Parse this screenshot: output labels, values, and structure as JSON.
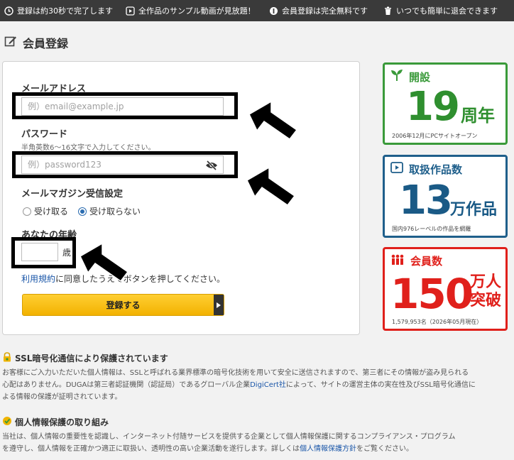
{
  "topbar": {
    "items": [
      {
        "icon": "clock-icon",
        "text": "登録は約30秒で完了します"
      },
      {
        "icon": "play-icon",
        "text": "全作品のサンプル動画が見放題！"
      },
      {
        "icon": "free-icon",
        "text": "会員登録は完全無料です"
      },
      {
        "icon": "trash-icon",
        "text": "いつでも簡単に退会できます"
      }
    ]
  },
  "page": {
    "title": "会員登録",
    "title_icon": "edit-icon"
  },
  "form": {
    "email_label": "メールアドレス",
    "email_placeholder": "例）email@example.jp",
    "password_label": "パスワード",
    "password_hint": "半角英数6～16文字で入力してください。",
    "password_placeholder": "例）password123",
    "password_toggle_icon": "eye-slash-icon",
    "newsletter_label": "メールマガジン受信設定",
    "newsletter_options": [
      {
        "label": "受け取る",
        "selected": false
      },
      {
        "label": "受け取らない",
        "selected": true
      }
    ],
    "age_label": "あなたの年齢",
    "age_value": "",
    "age_unit": "歳",
    "terms_link": "利用規約",
    "terms_text_1": "に同意したうえで",
    "terms_text_2": "ボタンを押してください。",
    "submit_label": "登録する"
  },
  "stats": [
    {
      "icon": "sprout-icon",
      "title": "開設",
      "number": "19",
      "unit": "周年",
      "note": "2006年12月にPCサイトオープン",
      "color": "#3a9a3a",
      "number_color": "#2f8f2f"
    },
    {
      "icon": "video-icon",
      "title": "取扱作品数",
      "number": "13",
      "unit": "万作品",
      "note": "国内976レーベルの作品を網羅",
      "color": "#1f5f8b",
      "number_color": "#1a5a86"
    },
    {
      "icon": "people-icon",
      "title": "会員数",
      "number": "150",
      "unit_line1": "万人",
      "unit_line2": "突破",
      "note": "1,579,953名（2026年05月現在）",
      "color": "#e0201b",
      "number_color": "#e0201b"
    }
  ],
  "security": {
    "ssl_title": "SSL暗号化通信により保護されています",
    "ssl_line1": "お客様にご入力いただいた個人情報は、SSLと呼ばれる業界標準の暗号化技術を用いて安全に送信されますので、第三者にその情報が盗み見られる",
    "ssl_line2a": "心配はありません。DUGAは第三者認証機関（認証局）であるグローバル企業",
    "ssl_link": "DigiCert社",
    "ssl_line2b": "によって、サイトの運営主体の実在性及びSSL暗号化通信に",
    "ssl_line3": "よる情報の保護が証明されています。",
    "privacy_title": "個人情報保護の取り組み",
    "privacy_line1": "当社は、個人情報の重要性を認識し、インターネット付随サービスを提供する企業として個人情報保護に関するコンプライアンス・プログラム",
    "privacy_line2a": "を遵守し、個人情報を正確かつ適正に取扱い、透明性の高い企業活動を遂行します。詳しくは",
    "privacy_link": "個人情報保護方針",
    "privacy_line2b": "をご覧ください。"
  }
}
